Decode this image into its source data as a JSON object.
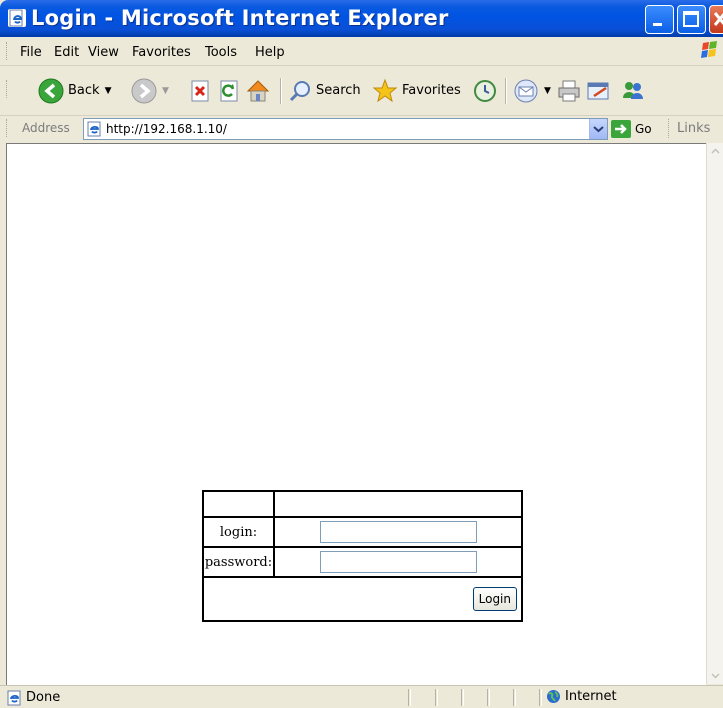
{
  "window": {
    "title": "Login - Microsoft Internet Explorer"
  },
  "menu": {
    "items": [
      "File",
      "Edit",
      "View",
      "Favorites",
      "Tools",
      "Help"
    ]
  },
  "toolbar": {
    "back_label": "Back",
    "search_label": "Search",
    "favorites_label": "Favorites"
  },
  "address": {
    "label": "Address",
    "url": "http://192.168.1.10/",
    "go_label": "Go",
    "links_label": "Links"
  },
  "login_form": {
    "login_label": "login:",
    "password_label": "password:",
    "login_value": "",
    "password_value": "",
    "submit_label": "Login"
  },
  "status": {
    "text": "Done",
    "zone": "Internet"
  },
  "colors": {
    "titlebar": "#0054e3",
    "chrome": "#ece9d8",
    "input_border": "#7f9db9"
  }
}
